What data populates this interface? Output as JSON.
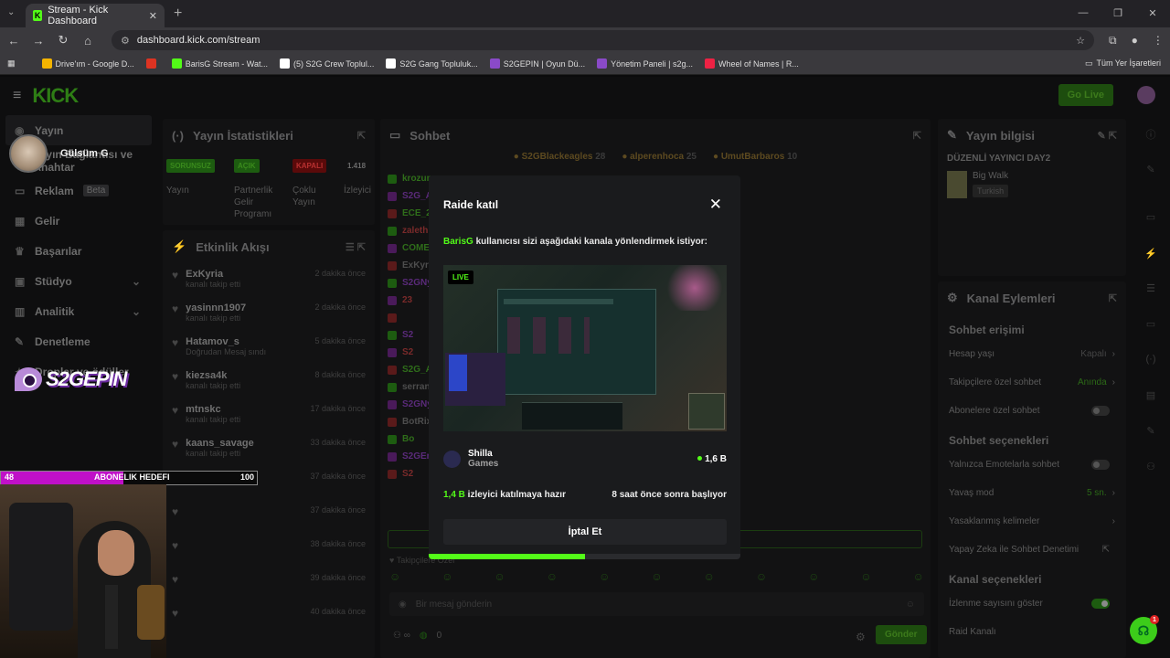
{
  "browser": {
    "tab_title": "Stream - Kick Dashboard",
    "url": "dashboard.kick.com/stream",
    "bookmarks": [
      {
        "label": "Drive'ım - Google D...",
        "color": "#f4b400"
      },
      {
        "label": "",
        "color": "#d32"
      },
      {
        "label": "BarisG Stream - Wat...",
        "color": "#53fc18"
      },
      {
        "label": "(5) S2G Crew Toplul...",
        "color": "#ffffff"
      },
      {
        "label": "S2G Gang Topluluk...",
        "color": "#ffffff"
      },
      {
        "label": "S2GEPIN | Oyun Dü...",
        "color": "#8a4ac8"
      },
      {
        "label": "Yönetim Paneli | s2g...",
        "color": "#8a4ac8"
      },
      {
        "label": "Wheel of Names | R...",
        "color": "#e24"
      }
    ],
    "all_bookmarks": "Tüm Yer İşaretleri"
  },
  "app": {
    "logo": "KICK",
    "go_live": "Go Live"
  },
  "sidebar": {
    "items": [
      {
        "icon": "broadcast-icon",
        "label": "Yayın"
      },
      {
        "icon": "link-icon",
        "label": "Yayın Bağlantısı ve Anahtar"
      },
      {
        "icon": "ad-icon",
        "label": "Reklam",
        "badge": "Beta"
      },
      {
        "icon": "money-icon",
        "label": "Gelir"
      },
      {
        "icon": "trophy-icon",
        "label": "Başarılar"
      },
      {
        "icon": "studio-icon",
        "label": "Stüdyo"
      },
      {
        "icon": "analytics-icon",
        "label": "Analitik"
      },
      {
        "icon": "moderation-icon",
        "label": "Denetleme"
      },
      {
        "icon": "gift-icon",
        "label": "Droplar ve ödüller"
      }
    ]
  },
  "stats_panel": {
    "title": "Yayın İstatistikleri",
    "cols": [
      {
        "badge": "SORUNSUZ",
        "badge_color": "#1d5c10",
        "text_color": "#3a8a1c",
        "label": "Yayın"
      },
      {
        "badge": "AÇIK",
        "badge_color": "#1d5c10",
        "text_color": "#3a8a1c",
        "label": "Partnerlik Gelir Programı"
      },
      {
        "badge": "KAPALI",
        "badge_color": "#5a0a0a",
        "text_color": "#b83030",
        "label": "Çoklu Yayın"
      },
      {
        "badge": "1.418",
        "badge_color": "transparent",
        "text_color": "#6a6a6a",
        "label": "İzleyici"
      }
    ]
  },
  "activity_panel": {
    "title": "Etkinlik Akışı",
    "items": [
      {
        "name": "ExKyria",
        "sub": "kanalı takip etti",
        "time": "2 dakika önce"
      },
      {
        "name": "yasinnn1907",
        "sub": "kanalı takip etti",
        "time": "2 dakika önce"
      },
      {
        "name": "Hatamov_s",
        "sub": "Doğrudan Mesaj sındı",
        "time": "5 dakika önce"
      },
      {
        "name": "kiezsa4k",
        "sub": "kanalı takip etti",
        "time": "8 dakika önce"
      },
      {
        "name": "mtnskc",
        "sub": "kanalı takip etti",
        "time": "17 dakika önce"
      },
      {
        "name": "kaans_savage",
        "sub": "kanalı takip etti",
        "time": "33 dakika önce"
      },
      {
        "name": "",
        "sub": "",
        "time": "37 dakika önce"
      },
      {
        "name": "",
        "sub": "",
        "time": "37 dakika önce"
      },
      {
        "name": "",
        "sub": "",
        "time": "38 dakika önce"
      },
      {
        "name": "",
        "sub": "",
        "time": "39 dakika önce"
      },
      {
        "name": "",
        "sub": "",
        "time": "40 dakika önce"
      }
    ]
  },
  "chat_panel": {
    "title": "Sohbet",
    "top_users": [
      {
        "name": "S2GBlackeagles",
        "count": "28"
      },
      {
        "name": "alperenhoca",
        "count": "25"
      },
      {
        "name": "UmutBarbaros",
        "count": "10"
      }
    ],
    "lines": [
      "krozum",
      "S2G_A",
      "ECE_206",
      "zaleth",
      "COME",
      "ExKyria: r",
      "S2GNymp",
      "23",
      "",
      "S2",
      "S2",
      "S2G_A",
      "serranum",
      "S2GNymp",
      "BotRix",
      "Bo",
      "S2GEmir",
      "S2"
    ],
    "followers_only": "Takipçilere Özel",
    "placeholder": "Bir mesaj gönderin",
    "count": "0",
    "send": "Gönder"
  },
  "info_panel": {
    "title": "Yayın bilgisi",
    "stream_title": "DÜZENLİ YAYINCI DAY2",
    "category": "Big Walk",
    "language": "Turkish"
  },
  "channel_panel": {
    "title": "Kanal Eylemleri",
    "sections": [
      {
        "title": "Sohbet erişimi",
        "items": [
          {
            "label": "Hesap yaşı",
            "value": "Kapalı",
            "kind": "arrow"
          },
          {
            "label": "Takipçilere özel sohbet",
            "value": "Anında",
            "kind": "arrow-green"
          },
          {
            "label": "Abonelere özel sohbet",
            "value": "",
            "kind": "toggle"
          }
        ]
      },
      {
        "title": "Sohbet seçenekleri",
        "items": [
          {
            "label": "Yalnızca Emotelarla sohbet",
            "value": "",
            "kind": "toggle"
          },
          {
            "label": "Yavaş mod",
            "value": "5 sn.",
            "kind": "arrow-green"
          },
          {
            "label": "Yasaklanmış kelimeler",
            "value": "",
            "kind": "arrow"
          },
          {
            "label": "Yapay Zeka ile Sohbet Denetimi",
            "value": "",
            "kind": "ext"
          }
        ]
      },
      {
        "title": "Kanal seçenekleri",
        "items": [
          {
            "label": "İzlenme sayısını göster",
            "value": "",
            "kind": "toggle-on"
          },
          {
            "label": "Raid Kanalı",
            "value": "",
            "kind": "none"
          }
        ]
      }
    ]
  },
  "overlay": {
    "user_name": "Gülsüm G",
    "goal_label": "ABONELIK HEDEFI",
    "goal_current": "48",
    "goal_target": "100",
    "goal_fraction": 0.48,
    "brand": "S2GEPIN"
  },
  "modal": {
    "title": "Raide katıl",
    "requester": "BarisG",
    "desc_rest": " kullanıcısı sizi aşağıdaki kanala yönlendirmek istiyor:",
    "live_label": "LIVE",
    "channel_name": "Shilla",
    "channel_category": "Games",
    "viewers": "1,6 B",
    "ready_count": "1,4 B",
    "ready_text": " izleyici katılmaya hazır",
    "starts_in": "8 saat önce sonra başlıyor",
    "cancel": "İptal Et",
    "progress_fraction": 0.5
  },
  "support_badge": "1"
}
